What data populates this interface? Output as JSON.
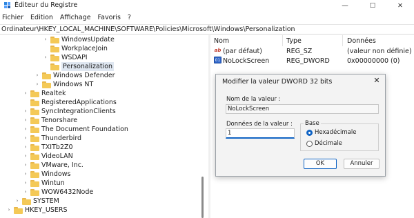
{
  "window": {
    "title": "Éditeur du Registre",
    "minimize_glyph": "—",
    "maximize_glyph": "☐",
    "close_glyph": "✕"
  },
  "menu": [
    "Fichier",
    "Edition",
    "Affichage",
    "Favoris",
    "?"
  ],
  "address": "Ordinateur\\HKEY_LOCAL_MACHINE\\SOFTWARE\\Policies\\Microsoft\\Windows\\Personalization",
  "tree": {
    "items": [
      {
        "label": "WindowsUpdate",
        "expander": "›",
        "selected": false
      },
      {
        "label": "WorkplaceJoin",
        "expander": "",
        "selected": false
      },
      {
        "label": "WSDAPI",
        "expander": "›",
        "selected": false
      },
      {
        "label": "Personalization",
        "expander": "",
        "selected": true
      },
      {
        "label": "Windows Defender",
        "expander": "›",
        "selected": false
      },
      {
        "label": "Windows NT",
        "expander": "›",
        "selected": false
      },
      {
        "label": "Realtek",
        "expander": "›",
        "selected": false
      },
      {
        "label": "RegisteredApplications",
        "expander": "",
        "selected": false
      },
      {
        "label": "SyncIntegrationClients",
        "expander": "›",
        "selected": false
      },
      {
        "label": "Tenorshare",
        "expander": "›",
        "selected": false
      },
      {
        "label": "The Document Foundation",
        "expander": "›",
        "selected": false
      },
      {
        "label": "Thunderbird",
        "expander": "›",
        "selected": false
      },
      {
        "label": "TXITb2Z0",
        "expander": "›",
        "selected": false
      },
      {
        "label": "VideoLAN",
        "expander": "›",
        "selected": false
      },
      {
        "label": "VMware, Inc.",
        "expander": "›",
        "selected": false
      },
      {
        "label": "Windows",
        "expander": "›",
        "selected": false
      },
      {
        "label": "Wintun",
        "expander": "›",
        "selected": false
      },
      {
        "label": "WOW6432Node",
        "expander": "›",
        "selected": false
      },
      {
        "label": "SYSTEM",
        "expander": "›",
        "selected": false
      },
      {
        "label": "HKEY_USERS",
        "expander": "›",
        "selected": false
      }
    ]
  },
  "list": {
    "headers": {
      "name": "Nom",
      "type": "Type",
      "data": "Données"
    },
    "rows": [
      {
        "icon": "string-value-icon",
        "icon_glyph": "ab",
        "name": "(par défaut)",
        "type": "REG_SZ",
        "data": "(valeur non définie)"
      },
      {
        "icon": "dword-value-icon",
        "icon_glyph": "01",
        "name": "NoLockScreen",
        "type": "REG_DWORD",
        "data": "0x00000000 (0)"
      }
    ]
  },
  "dialog": {
    "title": "Modifier la valeur DWORD 32 bits",
    "close_glyph": "✕",
    "name_label": "Nom de la valeur :",
    "name_value": "NoLockScreen",
    "data_label": "Données de la valeur :",
    "data_value": "1",
    "base_label": "Base",
    "radio_hex": "Hexadécimale",
    "radio_dec": "Décimale",
    "ok_label": "OK",
    "cancel_label": "Annuler"
  },
  "colors": {
    "accent": "#0f63c4",
    "folder": "#f4c957",
    "selection": "#dfe7f1"
  }
}
